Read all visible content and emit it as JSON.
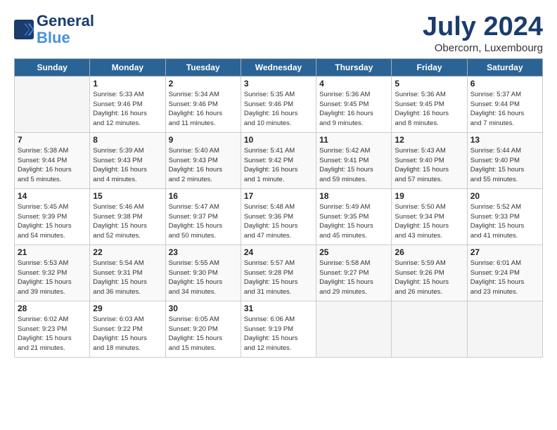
{
  "header": {
    "logo_line1": "General",
    "logo_line2": "Blue",
    "month": "July 2024",
    "location": "Obercorn, Luxembourg"
  },
  "days_of_week": [
    "Sunday",
    "Monday",
    "Tuesday",
    "Wednesday",
    "Thursday",
    "Friday",
    "Saturday"
  ],
  "weeks": [
    [
      {
        "day": "",
        "text": ""
      },
      {
        "day": "1",
        "text": "Sunrise: 5:33 AM\nSunset: 9:46 PM\nDaylight: 16 hours\nand 12 minutes."
      },
      {
        "day": "2",
        "text": "Sunrise: 5:34 AM\nSunset: 9:46 PM\nDaylight: 16 hours\nand 11 minutes."
      },
      {
        "day": "3",
        "text": "Sunrise: 5:35 AM\nSunset: 9:46 PM\nDaylight: 16 hours\nand 10 minutes."
      },
      {
        "day": "4",
        "text": "Sunrise: 5:36 AM\nSunset: 9:45 PM\nDaylight: 16 hours\nand 9 minutes."
      },
      {
        "day": "5",
        "text": "Sunrise: 5:36 AM\nSunset: 9:45 PM\nDaylight: 16 hours\nand 8 minutes."
      },
      {
        "day": "6",
        "text": "Sunrise: 5:37 AM\nSunset: 9:44 PM\nDaylight: 16 hours\nand 7 minutes."
      }
    ],
    [
      {
        "day": "7",
        "text": "Sunrise: 5:38 AM\nSunset: 9:44 PM\nDaylight: 16 hours\nand 5 minutes."
      },
      {
        "day": "8",
        "text": "Sunrise: 5:39 AM\nSunset: 9:43 PM\nDaylight: 16 hours\nand 4 minutes."
      },
      {
        "day": "9",
        "text": "Sunrise: 5:40 AM\nSunset: 9:43 PM\nDaylight: 16 hours\nand 2 minutes."
      },
      {
        "day": "10",
        "text": "Sunrise: 5:41 AM\nSunset: 9:42 PM\nDaylight: 16 hours\nand 1 minute."
      },
      {
        "day": "11",
        "text": "Sunrise: 5:42 AM\nSunset: 9:41 PM\nDaylight: 15 hours\nand 59 minutes."
      },
      {
        "day": "12",
        "text": "Sunrise: 5:43 AM\nSunset: 9:40 PM\nDaylight: 15 hours\nand 57 minutes."
      },
      {
        "day": "13",
        "text": "Sunrise: 5:44 AM\nSunset: 9:40 PM\nDaylight: 15 hours\nand 55 minutes."
      }
    ],
    [
      {
        "day": "14",
        "text": "Sunrise: 5:45 AM\nSunset: 9:39 PM\nDaylight: 15 hours\nand 54 minutes."
      },
      {
        "day": "15",
        "text": "Sunrise: 5:46 AM\nSunset: 9:38 PM\nDaylight: 15 hours\nand 52 minutes."
      },
      {
        "day": "16",
        "text": "Sunrise: 5:47 AM\nSunset: 9:37 PM\nDaylight: 15 hours\nand 50 minutes."
      },
      {
        "day": "17",
        "text": "Sunrise: 5:48 AM\nSunset: 9:36 PM\nDaylight: 15 hours\nand 47 minutes."
      },
      {
        "day": "18",
        "text": "Sunrise: 5:49 AM\nSunset: 9:35 PM\nDaylight: 15 hours\nand 45 minutes."
      },
      {
        "day": "19",
        "text": "Sunrise: 5:50 AM\nSunset: 9:34 PM\nDaylight: 15 hours\nand 43 minutes."
      },
      {
        "day": "20",
        "text": "Sunrise: 5:52 AM\nSunset: 9:33 PM\nDaylight: 15 hours\nand 41 minutes."
      }
    ],
    [
      {
        "day": "21",
        "text": "Sunrise: 5:53 AM\nSunset: 9:32 PM\nDaylight: 15 hours\nand 39 minutes."
      },
      {
        "day": "22",
        "text": "Sunrise: 5:54 AM\nSunset: 9:31 PM\nDaylight: 15 hours\nand 36 minutes."
      },
      {
        "day": "23",
        "text": "Sunrise: 5:55 AM\nSunset: 9:30 PM\nDaylight: 15 hours\nand 34 minutes."
      },
      {
        "day": "24",
        "text": "Sunrise: 5:57 AM\nSunset: 9:28 PM\nDaylight: 15 hours\nand 31 minutes."
      },
      {
        "day": "25",
        "text": "Sunrise: 5:58 AM\nSunset: 9:27 PM\nDaylight: 15 hours\nand 29 minutes."
      },
      {
        "day": "26",
        "text": "Sunrise: 5:59 AM\nSunset: 9:26 PM\nDaylight: 15 hours\nand 26 minutes."
      },
      {
        "day": "27",
        "text": "Sunrise: 6:01 AM\nSunset: 9:24 PM\nDaylight: 15 hours\nand 23 minutes."
      }
    ],
    [
      {
        "day": "28",
        "text": "Sunrise: 6:02 AM\nSunset: 9:23 PM\nDaylight: 15 hours\nand 21 minutes."
      },
      {
        "day": "29",
        "text": "Sunrise: 6:03 AM\nSunset: 9:22 PM\nDaylight: 15 hours\nand 18 minutes."
      },
      {
        "day": "30",
        "text": "Sunrise: 6:05 AM\nSunset: 9:20 PM\nDaylight: 15 hours\nand 15 minutes."
      },
      {
        "day": "31",
        "text": "Sunrise: 6:06 AM\nSunset: 9:19 PM\nDaylight: 15 hours\nand 12 minutes."
      },
      {
        "day": "",
        "text": ""
      },
      {
        "day": "",
        "text": ""
      },
      {
        "day": "",
        "text": ""
      }
    ]
  ]
}
